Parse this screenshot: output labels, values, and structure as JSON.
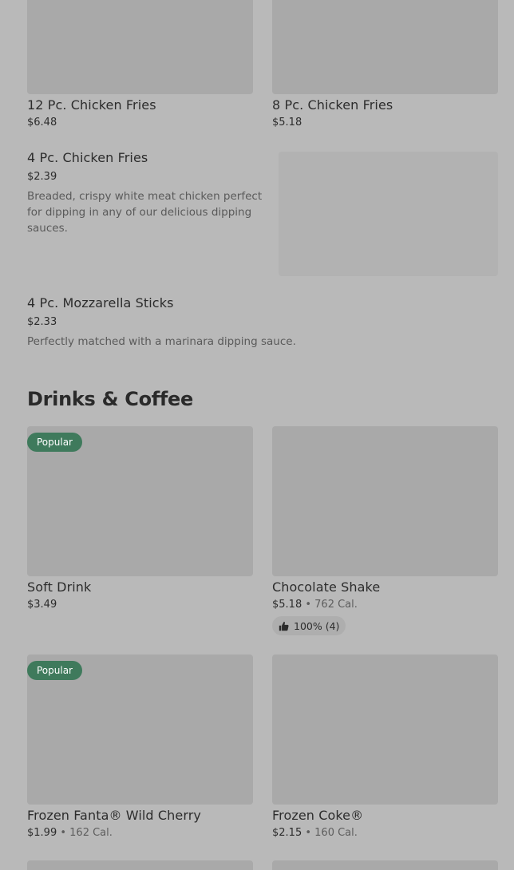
{
  "items_top": [
    {
      "title": "12 Pc. Chicken Fries",
      "price": "$6.48"
    },
    {
      "title": "8 Pc. Chicken Fries",
      "price": "$5.18"
    }
  ],
  "item_4pc_fries": {
    "title": "4 Pc. Chicken Fries",
    "price": "$2.39",
    "description": "Breaded, crispy white meat chicken perfect for dipping in any of our delicious dipping sauces."
  },
  "item_mozz": {
    "title": "4 Pc. Mozzarella Sticks",
    "price": "$2.33",
    "description": "Perfectly matched with a marinara dipping sauce."
  },
  "section": {
    "title": "Drinks & Coffee"
  },
  "drinks": [
    {
      "title": "Soft Drink",
      "price": "$3.49",
      "badge": "Popular"
    },
    {
      "title": "Chocolate Shake",
      "price": "$5.18",
      "separator": " • ",
      "calories": "762 Cal.",
      "rating": "100% (4)"
    },
    {
      "title": "Frozen Fanta® Wild Cherry",
      "price": "$1.99",
      "separator": " • ",
      "calories": "162 Cal.",
      "badge": "Popular"
    },
    {
      "title": "Frozen Coke®",
      "price": "$2.15",
      "separator": " • ",
      "calories": "160 Cal."
    }
  ],
  "colors": {
    "badge_bg": "#3f7a5c",
    "background": "#b9b9b9",
    "image_placeholder": "#a9a9a9"
  },
  "icons": {
    "rating": "thumbs-up-icon"
  }
}
